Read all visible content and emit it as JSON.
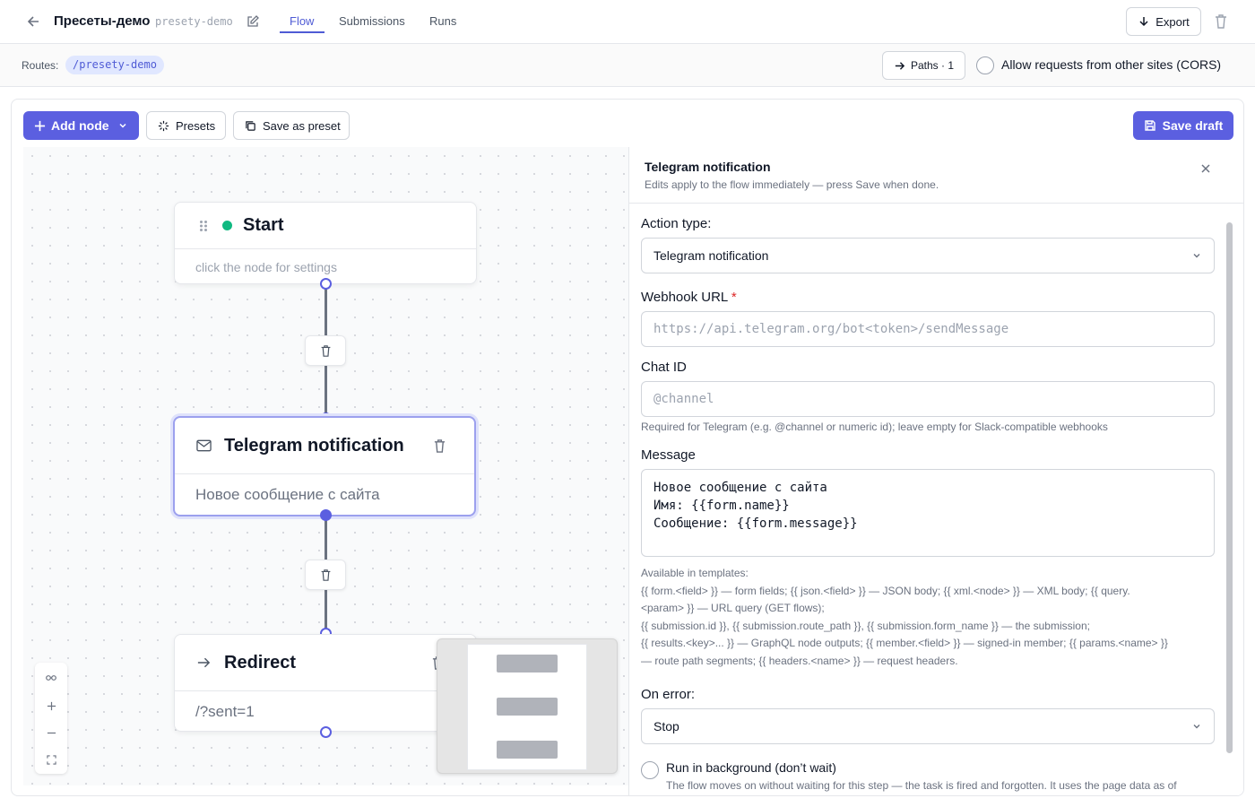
{
  "header": {
    "title": "Пресеты-демо",
    "slug": "presety-demo",
    "tabs": [
      {
        "label": "Flow",
        "active": true
      },
      {
        "label": "Submissions",
        "active": false
      },
      {
        "label": "Runs",
        "active": false
      }
    ],
    "export_label": "Export"
  },
  "routes": {
    "label": "Routes:",
    "path": "/presety-demo",
    "paths_label": "Paths · 1",
    "cors_label": "Allow requests from other sites (CORS)"
  },
  "toolbar": {
    "add_node_label": "Add node",
    "presets_label": "Presets",
    "save_preset_label": "Save as preset",
    "save_draft_label": "Save draft"
  },
  "canvas": {
    "nodes": [
      {
        "title": "Start",
        "body": "click the node for settings",
        "icon": "drag-handle-icon",
        "status_color": "#10b981"
      },
      {
        "title": "Telegram notification",
        "body": "Новое сообщение с сайта",
        "icon": "mail-icon",
        "selected": true
      },
      {
        "title": "Redirect",
        "body": "/?sent=1",
        "icon": "arrow-right-icon"
      }
    ]
  },
  "panel": {
    "title": "Telegram notification",
    "subtitle": "Edits apply to the flow immediately — press Save when done.",
    "action_type_label": "Action type:",
    "action_type_value": "Telegram notification",
    "webhook_label": "Webhook URL",
    "webhook_required": "*",
    "webhook_placeholder": "https://api.telegram.org/bot<token>/sendMessage",
    "chat_id_label": "Chat ID",
    "chat_id_placeholder": "@channel",
    "chat_id_help": "Required for Telegram (e.g. @channel or numeric id); leave empty for Slack-compatible webhooks",
    "message_label": "Message",
    "message_value": "Новое сообщение с сайта\nИмя: {{form.name}}\nСообщение: {{form.message}}",
    "templates_help": [
      "Available in templates:",
      "{{ form.<field> }} — form fields; {{ json.<field> }} — JSON body; {{ xml.<node> }} — XML body; {{ query.",
      "<param> }} — URL query (GET flows);",
      "{{ submission.id }}, {{ submission.route_path }}, {{ submission.form_name }} — the submission;",
      "{{ results.<key>... }} — GraphQL node outputs; {{ member.<field> }} — signed-in member; {{ params.<name> }}",
      "— route path segments; {{ headers.<name> }} — request headers."
    ],
    "on_error_label": "On error:",
    "on_error_value": "Stop",
    "run_bg_label": "Run in background (don’t wait)",
    "run_bg_help": "The flow moves on without waiting for this step — the task is fired and forgotten. It uses the page data as of"
  },
  "colors": {
    "accent": "#5b5fe0",
    "success": "#10b981",
    "required": "#dc2626"
  }
}
